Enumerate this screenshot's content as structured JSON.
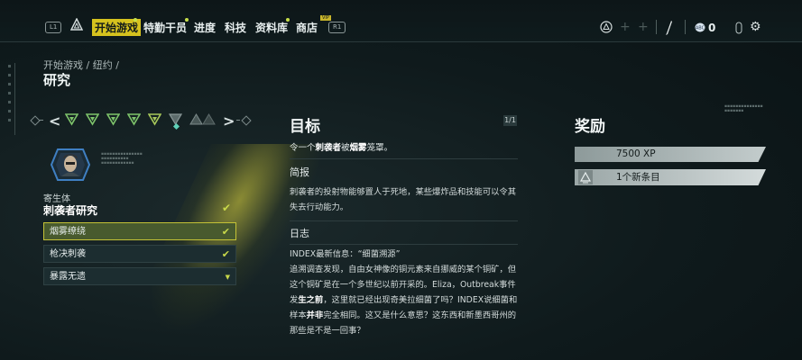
{
  "topbar": {
    "key_left": "L1",
    "key_right": "R1",
    "tabs": [
      {
        "label": "开始游戏",
        "active": true
      },
      {
        "label": "特勤干员",
        "active": false
      },
      {
        "label": "进度",
        "active": false
      },
      {
        "label": "科技",
        "active": false
      },
      {
        "label": "资料库",
        "active": false
      },
      {
        "label": "商店",
        "active": false
      }
    ],
    "vip_badge": "VIP",
    "currency_value": "0",
    "icons": [
      "triangle-logo-icon",
      "triangle-button-icon",
      "plus-icon",
      "plus-icon",
      "blade-icon",
      "coin-icon",
      "controller-icon",
      "gear-icon"
    ]
  },
  "breadcrumb": "开始游戏 / 纽约 /",
  "page_title": "研究",
  "left_card": {
    "subtitle": "寄生体",
    "title": "刺袭者研究",
    "rows": [
      {
        "label": "烟雾缭绕",
        "status": "complete",
        "selected": true
      },
      {
        "label": "枪决刺袭",
        "status": "complete",
        "selected": false
      },
      {
        "label": "暴露无遗",
        "status": "locked",
        "selected": false
      }
    ],
    "accent_color": "#c8d84a"
  },
  "objective": {
    "heading": "目标",
    "counter": "1/1",
    "text_pre": "令一个",
    "text_b1": "刺袭者",
    "text_mid": "被",
    "text_b2": "烟雾",
    "text_post": "笼罩。"
  },
  "brief": {
    "heading": "简报",
    "text": "刺袭者的投射物能够置人于死地，某些爆炸品和技能可以令其失去行动能力。"
  },
  "log": {
    "heading": "日志",
    "line1": "INDEX最新信息：“细菌溯源”",
    "p1": "追溯调查发现，自由女神像的铜元素来自挪威的某个铜矿，但这个铜矿是在一个多世纪以前开采的。Eliza，Outbreak事件发",
    "p2_b1": "生之前",
    "p2_rest": "，这里就已经出现奇美拉细菌了吗？INDEX说细菌和样",
    "p3_pre": "本",
    "p3_b": "并非",
    "p3_rest": "完全相同。这又是什么意思？这东西和新墨西哥州的那些是不是一回事？"
  },
  "rewards": {
    "heading": "奖励",
    "items": [
      {
        "label": "7500 XP"
      },
      {
        "label": "1个新条目"
      }
    ]
  }
}
